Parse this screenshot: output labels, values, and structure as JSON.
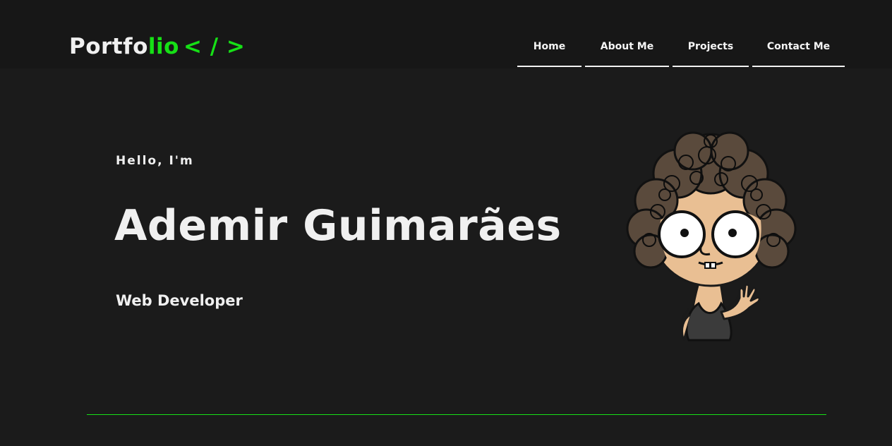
{
  "header": {
    "logo": {
      "part1": "Portfo",
      "part2": "lio",
      "part3": "< / >"
    },
    "nav": [
      {
        "label": "Home"
      },
      {
        "label": "About Me"
      },
      {
        "label": "Projects"
      },
      {
        "label": "Contact Me"
      }
    ]
  },
  "hero": {
    "greeting": "Hello, I'm",
    "name": "Ademir Guimarães",
    "role": "Web Developer"
  },
  "colors": {
    "background": "#1b1b1b",
    "header_background": "#171717",
    "accent": "#16e016",
    "text": "#f0f0f0"
  }
}
